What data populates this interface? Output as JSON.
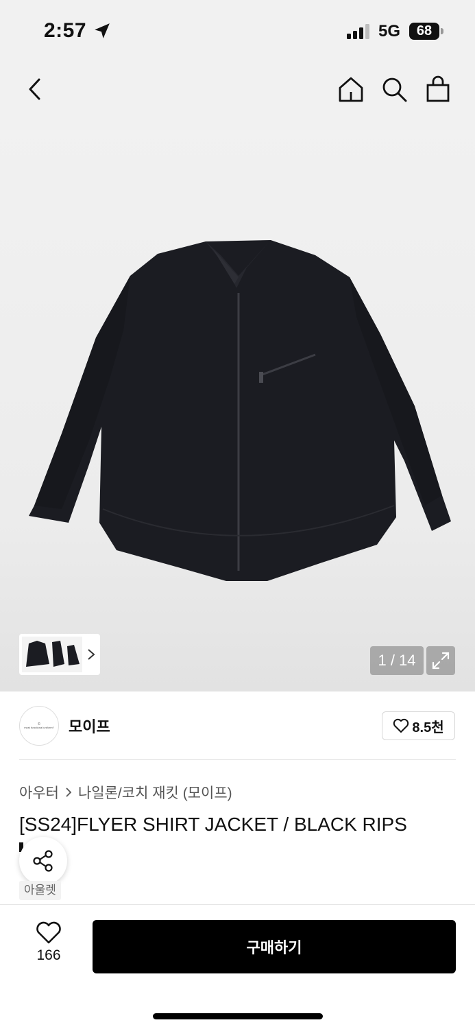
{
  "status_bar": {
    "time": "2:57",
    "network": "5G",
    "battery": "68"
  },
  "nav": {
    "back_icon": "chevron-left-icon",
    "home_icon": "home-icon",
    "search_icon": "search-icon",
    "cart_icon": "shopping-bag-icon"
  },
  "gallery": {
    "counter": "1 / 14",
    "expand_icon": "expand-icon"
  },
  "brand": {
    "name": "모이프",
    "like_count": "8.5천",
    "logo_mark": "©",
    "logo_text": "most functional uniform?"
  },
  "product": {
    "breadcrumb": [
      "아우터",
      "나일론/코치 재킷 (모이프)"
    ],
    "title": "[SS24]FLYER SHIRT JACKET / BLACK RIPS",
    "tag": "아울렛"
  },
  "bottom": {
    "wish_count": "166",
    "buy_label": "구매하기"
  },
  "colors": {
    "accent": "#000000",
    "hero_bg": "#f1f1f1",
    "jacket": "#1b1c22"
  }
}
